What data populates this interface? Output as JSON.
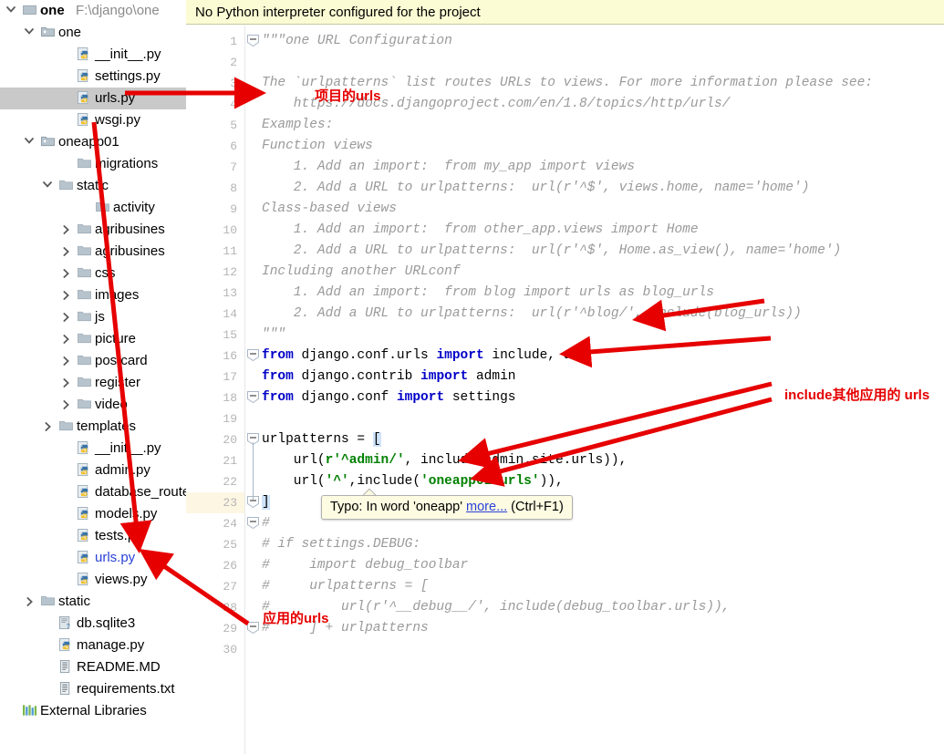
{
  "sidebar": {
    "rows": [
      {
        "depth": 0,
        "twisty": "down",
        "icon": "module-folder-icon",
        "label": "one",
        "path": "F:\\django\\one",
        "bold": true
      },
      {
        "depth": 1,
        "twisty": "down",
        "icon": "package-folder-icon",
        "label": "one"
      },
      {
        "depth": 3,
        "twisty": "none",
        "icon": "python-file-icon",
        "label": "__init__.py"
      },
      {
        "depth": 3,
        "twisty": "none",
        "icon": "python-file-icon",
        "label": "settings.py"
      },
      {
        "depth": 3,
        "twisty": "none",
        "icon": "python-file-icon",
        "label": "urls.py",
        "selected": true
      },
      {
        "depth": 3,
        "twisty": "none",
        "icon": "python-file-icon",
        "label": "wsgi.py"
      },
      {
        "depth": 1,
        "twisty": "down",
        "icon": "package-folder-icon",
        "label": "oneapp01"
      },
      {
        "depth": 3,
        "twisty": "none",
        "icon": "folder-icon",
        "label": "migrations"
      },
      {
        "depth": 2,
        "twisty": "down",
        "icon": "folder-icon",
        "label": "static"
      },
      {
        "depth": 4,
        "twisty": "none",
        "icon": "folder-icon",
        "label": "activity"
      },
      {
        "depth": 3,
        "twisty": "right",
        "icon": "folder-icon",
        "label": "agribusines"
      },
      {
        "depth": 3,
        "twisty": "right",
        "icon": "folder-icon",
        "label": "agribusines"
      },
      {
        "depth": 3,
        "twisty": "right",
        "icon": "folder-icon",
        "label": "css"
      },
      {
        "depth": 3,
        "twisty": "right",
        "icon": "folder-icon",
        "label": "images"
      },
      {
        "depth": 3,
        "twisty": "right",
        "icon": "folder-icon",
        "label": "js"
      },
      {
        "depth": 3,
        "twisty": "right",
        "icon": "folder-icon",
        "label": "picture"
      },
      {
        "depth": 3,
        "twisty": "right",
        "icon": "folder-icon",
        "label": "postcard"
      },
      {
        "depth": 3,
        "twisty": "right",
        "icon": "folder-icon",
        "label": "register"
      },
      {
        "depth": 3,
        "twisty": "right",
        "icon": "folder-icon",
        "label": "video"
      },
      {
        "depth": 2,
        "twisty": "right",
        "icon": "folder-icon",
        "label": "templates"
      },
      {
        "depth": 3,
        "twisty": "none",
        "icon": "python-file-icon",
        "label": "__init__.py"
      },
      {
        "depth": 3,
        "twisty": "none",
        "icon": "python-file-icon",
        "label": "admin.py"
      },
      {
        "depth": 3,
        "twisty": "none",
        "icon": "python-file-icon",
        "label": "database_route"
      },
      {
        "depth": 3,
        "twisty": "none",
        "icon": "python-file-icon",
        "label": "models.py"
      },
      {
        "depth": 3,
        "twisty": "none",
        "icon": "python-file-icon",
        "label": "tests.py"
      },
      {
        "depth": 3,
        "twisty": "none",
        "icon": "python-file-icon",
        "label": "urls.py",
        "open": true
      },
      {
        "depth": 3,
        "twisty": "none",
        "icon": "python-file-icon",
        "label": "views.py"
      },
      {
        "depth": 1,
        "twisty": "right",
        "icon": "folder-icon",
        "label": "static"
      },
      {
        "depth": 2,
        "twisty": "none",
        "icon": "sqlite-file-icon",
        "label": "db.sqlite3"
      },
      {
        "depth": 2,
        "twisty": "none",
        "icon": "python-file-icon",
        "label": "manage.py"
      },
      {
        "depth": 2,
        "twisty": "none",
        "icon": "text-file-icon",
        "label": "README.MD"
      },
      {
        "depth": 2,
        "twisty": "none",
        "icon": "text-file-icon",
        "label": "requirements.txt"
      },
      {
        "depth": 0,
        "twisty": "none",
        "icon": "external-libraries-icon",
        "label": "External Libraries"
      }
    ]
  },
  "editor": {
    "banner": "No Python interpreter configured for the project",
    "current_line": 23,
    "line_numbers": [
      1,
      2,
      3,
      4,
      5,
      6,
      7,
      8,
      9,
      10,
      11,
      12,
      13,
      14,
      15,
      16,
      17,
      18,
      19,
      20,
      21,
      22,
      23,
      24,
      25,
      26,
      27,
      28,
      29,
      30
    ],
    "lines": [
      {
        "n": 1,
        "segments": [
          {
            "t": "\"\"\"one URL Configuration",
            "c": "cmt"
          }
        ]
      },
      {
        "n": 2,
        "segments": []
      },
      {
        "n": 3,
        "segments": [
          {
            "t": "The `urlpatterns` list routes URLs to views. For more information please see:",
            "c": "cmt"
          }
        ]
      },
      {
        "n": 4,
        "segments": [
          {
            "t": "    https://docs.djangoproject.com/en/1.8/topics/http/urls/",
            "c": "cmt"
          }
        ]
      },
      {
        "n": 5,
        "segments": [
          {
            "t": "Examples:",
            "c": "cmt"
          }
        ]
      },
      {
        "n": 6,
        "segments": [
          {
            "t": "Function views",
            "c": "cmt"
          }
        ]
      },
      {
        "n": 7,
        "segments": [
          {
            "t": "    1. Add an import:  from my_app import views",
            "c": "cmt"
          }
        ]
      },
      {
        "n": 8,
        "segments": [
          {
            "t": "    2. Add a URL to urlpatterns:  url(r'^$', views.home, name='home')",
            "c": "cmt"
          }
        ]
      },
      {
        "n": 9,
        "segments": [
          {
            "t": "Class-based views",
            "c": "cmt"
          }
        ]
      },
      {
        "n": 10,
        "segments": [
          {
            "t": "    1. Add an import:  from other_app.views import Home",
            "c": "cmt"
          }
        ]
      },
      {
        "n": 11,
        "segments": [
          {
            "t": "    2. Add a URL to urlpatterns:  url(r'^$', Home.as_view(), name='home')",
            "c": "cmt"
          }
        ]
      },
      {
        "n": 12,
        "segments": [
          {
            "t": "Including another URLconf",
            "c": "cmt"
          }
        ]
      },
      {
        "n": 13,
        "segments": [
          {
            "t": "    1. Add an import:  from blog import urls as blog_urls",
            "c": "cmt"
          }
        ]
      },
      {
        "n": 14,
        "segments": [
          {
            "t": "    2. Add a URL to urlpatterns:  url(r'^blog/', include(blog_urls))",
            "c": "cmt"
          }
        ]
      },
      {
        "n": 15,
        "segments": [
          {
            "t": "\"\"\"",
            "c": "cmt"
          }
        ]
      },
      {
        "n": 16,
        "segments": [
          {
            "t": "from",
            "c": "kw"
          },
          {
            "t": " django.conf.urls ",
            "c": "plain"
          },
          {
            "t": "import",
            "c": "kw"
          },
          {
            "t": " include, url",
            "c": "plain"
          }
        ]
      },
      {
        "n": 17,
        "segments": [
          {
            "t": "from",
            "c": "kw"
          },
          {
            "t": " django.contrib ",
            "c": "plain"
          },
          {
            "t": "import",
            "c": "kw"
          },
          {
            "t": " admin",
            "c": "plain"
          }
        ]
      },
      {
        "n": 18,
        "segments": [
          {
            "t": "from",
            "c": "kw"
          },
          {
            "t": " django.conf ",
            "c": "plain"
          },
          {
            "t": "import",
            "c": "kw"
          },
          {
            "t": " settings",
            "c": "plain"
          }
        ]
      },
      {
        "n": 19,
        "segments": []
      },
      {
        "n": 20,
        "segments": [
          {
            "t": "urlpatterns = ",
            "c": "plain"
          },
          {
            "t": "[",
            "c": "brk"
          }
        ]
      },
      {
        "n": 21,
        "segments": [
          {
            "t": "    url(",
            "c": "plain"
          },
          {
            "t": "r'^admin/'",
            "c": "str"
          },
          {
            "t": ", include(admin.site.urls)),",
            "c": "plain"
          }
        ]
      },
      {
        "n": 22,
        "segments": [
          {
            "t": "    url(",
            "c": "plain"
          },
          {
            "t": "'^'",
            "c": "str"
          },
          {
            "t": ",include(",
            "c": "plain"
          },
          {
            "t": "'oneapp01.urls'",
            "c": "str"
          },
          {
            "t": ")),",
            "c": "plain"
          }
        ]
      },
      {
        "n": 23,
        "segments": [
          {
            "t": "]",
            "c": "brk"
          }
        ]
      },
      {
        "n": 24,
        "segments": [
          {
            "t": "#",
            "c": "cmt"
          }
        ]
      },
      {
        "n": 25,
        "segments": [
          {
            "t": "# if settings.DEBUG:",
            "c": "cmt"
          }
        ]
      },
      {
        "n": 26,
        "segments": [
          {
            "t": "#     import debug_toolbar",
            "c": "cmt"
          }
        ]
      },
      {
        "n": 27,
        "segments": [
          {
            "t": "#     urlpatterns = [",
            "c": "cmt"
          }
        ]
      },
      {
        "n": 28,
        "segments": [
          {
            "t": "#         url(r'^__debug__/', include(debug_toolbar.urls)),",
            "c": "cmt"
          }
        ]
      },
      {
        "n": 29,
        "segments": [
          {
            "t": "#     ] + urlpatterns",
            "c": "cmt"
          }
        ]
      },
      {
        "n": 30,
        "segments": []
      }
    ]
  },
  "tooltip": {
    "prefix": "Typo: In word 'oneapp' ",
    "link": "more...",
    "suffix": " (Ctrl+F1)"
  },
  "annotations": [
    {
      "name": "annotation-project-urls",
      "text": "项目的urls"
    },
    {
      "name": "annotation-include-other-app-urls",
      "text": "include其他应用的 urls"
    },
    {
      "name": "annotation-app-urls",
      "text": "应用的urls"
    }
  ],
  "colors": {
    "annotation_red": "#e60000",
    "banner_yellow": "#fbfbd4",
    "selection_gray": "#c9c9c9",
    "current_line": "#fdf6e3",
    "keyword_blue": "#0000c8",
    "string_green": "#008000",
    "comment_gray": "#9a9a9a"
  }
}
